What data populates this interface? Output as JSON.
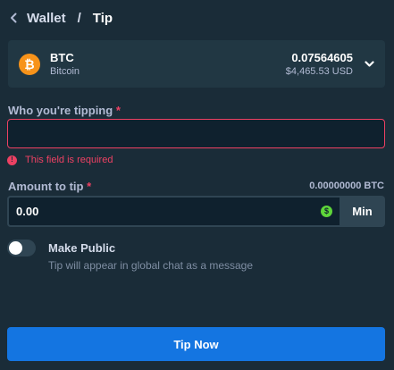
{
  "header": {
    "parent": "Wallet",
    "separator": "/",
    "current": "Tip"
  },
  "currency": {
    "code": "BTC",
    "name": "Bitcoin",
    "symbol": "₿",
    "balance": "0.07564605",
    "usd_value": "$4,465.53 USD",
    "icon": "bitcoin-coin-icon",
    "icon_color": "#f7931a"
  },
  "recipient": {
    "label": "Who you're tipping",
    "required_mark": "*",
    "value": "",
    "placeholder": "",
    "error": "This field is required",
    "error_color": "#ed4163"
  },
  "amount": {
    "label": "Amount to tip",
    "required_mark": "*",
    "balance": "0.00000000 BTC",
    "value": "0.00",
    "currency_icon": "usd-dollar-icon",
    "min_label": "Min"
  },
  "make_public": {
    "label": "Make Public",
    "hint": "Tip will appear in global chat as a message",
    "enabled": false
  },
  "submit": {
    "label": "Tip Now",
    "color": "#1475e1"
  }
}
